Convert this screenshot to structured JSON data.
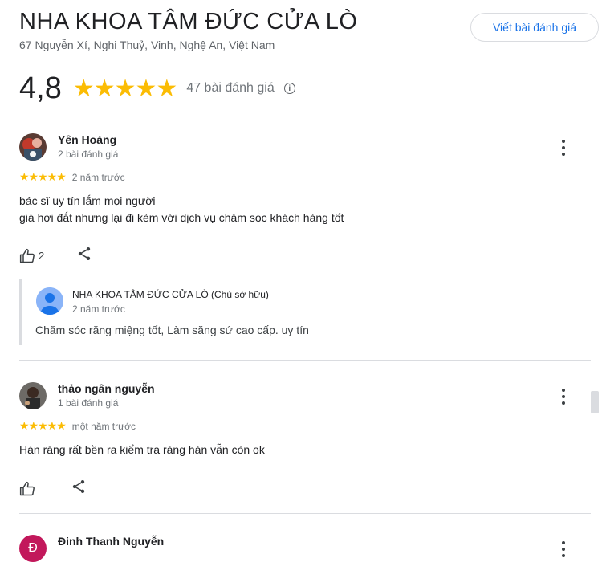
{
  "business": {
    "name": "NHA KHOA TÂM ĐỨC CỬA LÒ",
    "address": "67 Nguyễn Xí, Nghi Thuỷ, Vinh, Nghệ An, Việt Nam",
    "write_review_label": "Viết bài đánh giá"
  },
  "summary": {
    "rating": "4,8",
    "stars": "★★★★★",
    "rating_value": 4.8,
    "review_count": "47 bài đánh giá",
    "info_icon": "info-icon"
  },
  "reviews": [
    {
      "name": "Yên Hoàng",
      "meta": "2 bài đánh giá",
      "stars": "★★★★★",
      "rating_value": 5,
      "time": "2 năm trước",
      "text_lines": [
        "bác sĩ uy tín lắm mọi người",
        "giá hơi đắt nhưng lại đi kèm với dịch vụ chăm soc khách hàng tốt"
      ],
      "likes": "2",
      "owner_reply": {
        "name": "NHA KHOA TÂM ĐỨC CỬA LÒ (Chủ sở hữu)",
        "time": "2 năm trước",
        "text": "Chăm sóc răng miệng tốt, Làm săng sứ cao cấp. uy tín"
      }
    },
    {
      "name": "thảo ngân nguyễn",
      "meta": "1 bài đánh giá",
      "stars": "★★★★★",
      "rating_value": 5,
      "time": "một năm trước",
      "text_lines": [
        "Hàn răng rất bền ra kiểm tra răng hàn vẫn còn ok"
      ],
      "likes": ""
    },
    {
      "name": "Đinh Thanh Nguyễn",
      "avatar_letter": "Đ"
    }
  ],
  "colors": {
    "star": "#fbbc04",
    "accent": "#1a73e8",
    "avatar3": "#c2185b",
    "owner_avatar": "#8ab4f8"
  }
}
